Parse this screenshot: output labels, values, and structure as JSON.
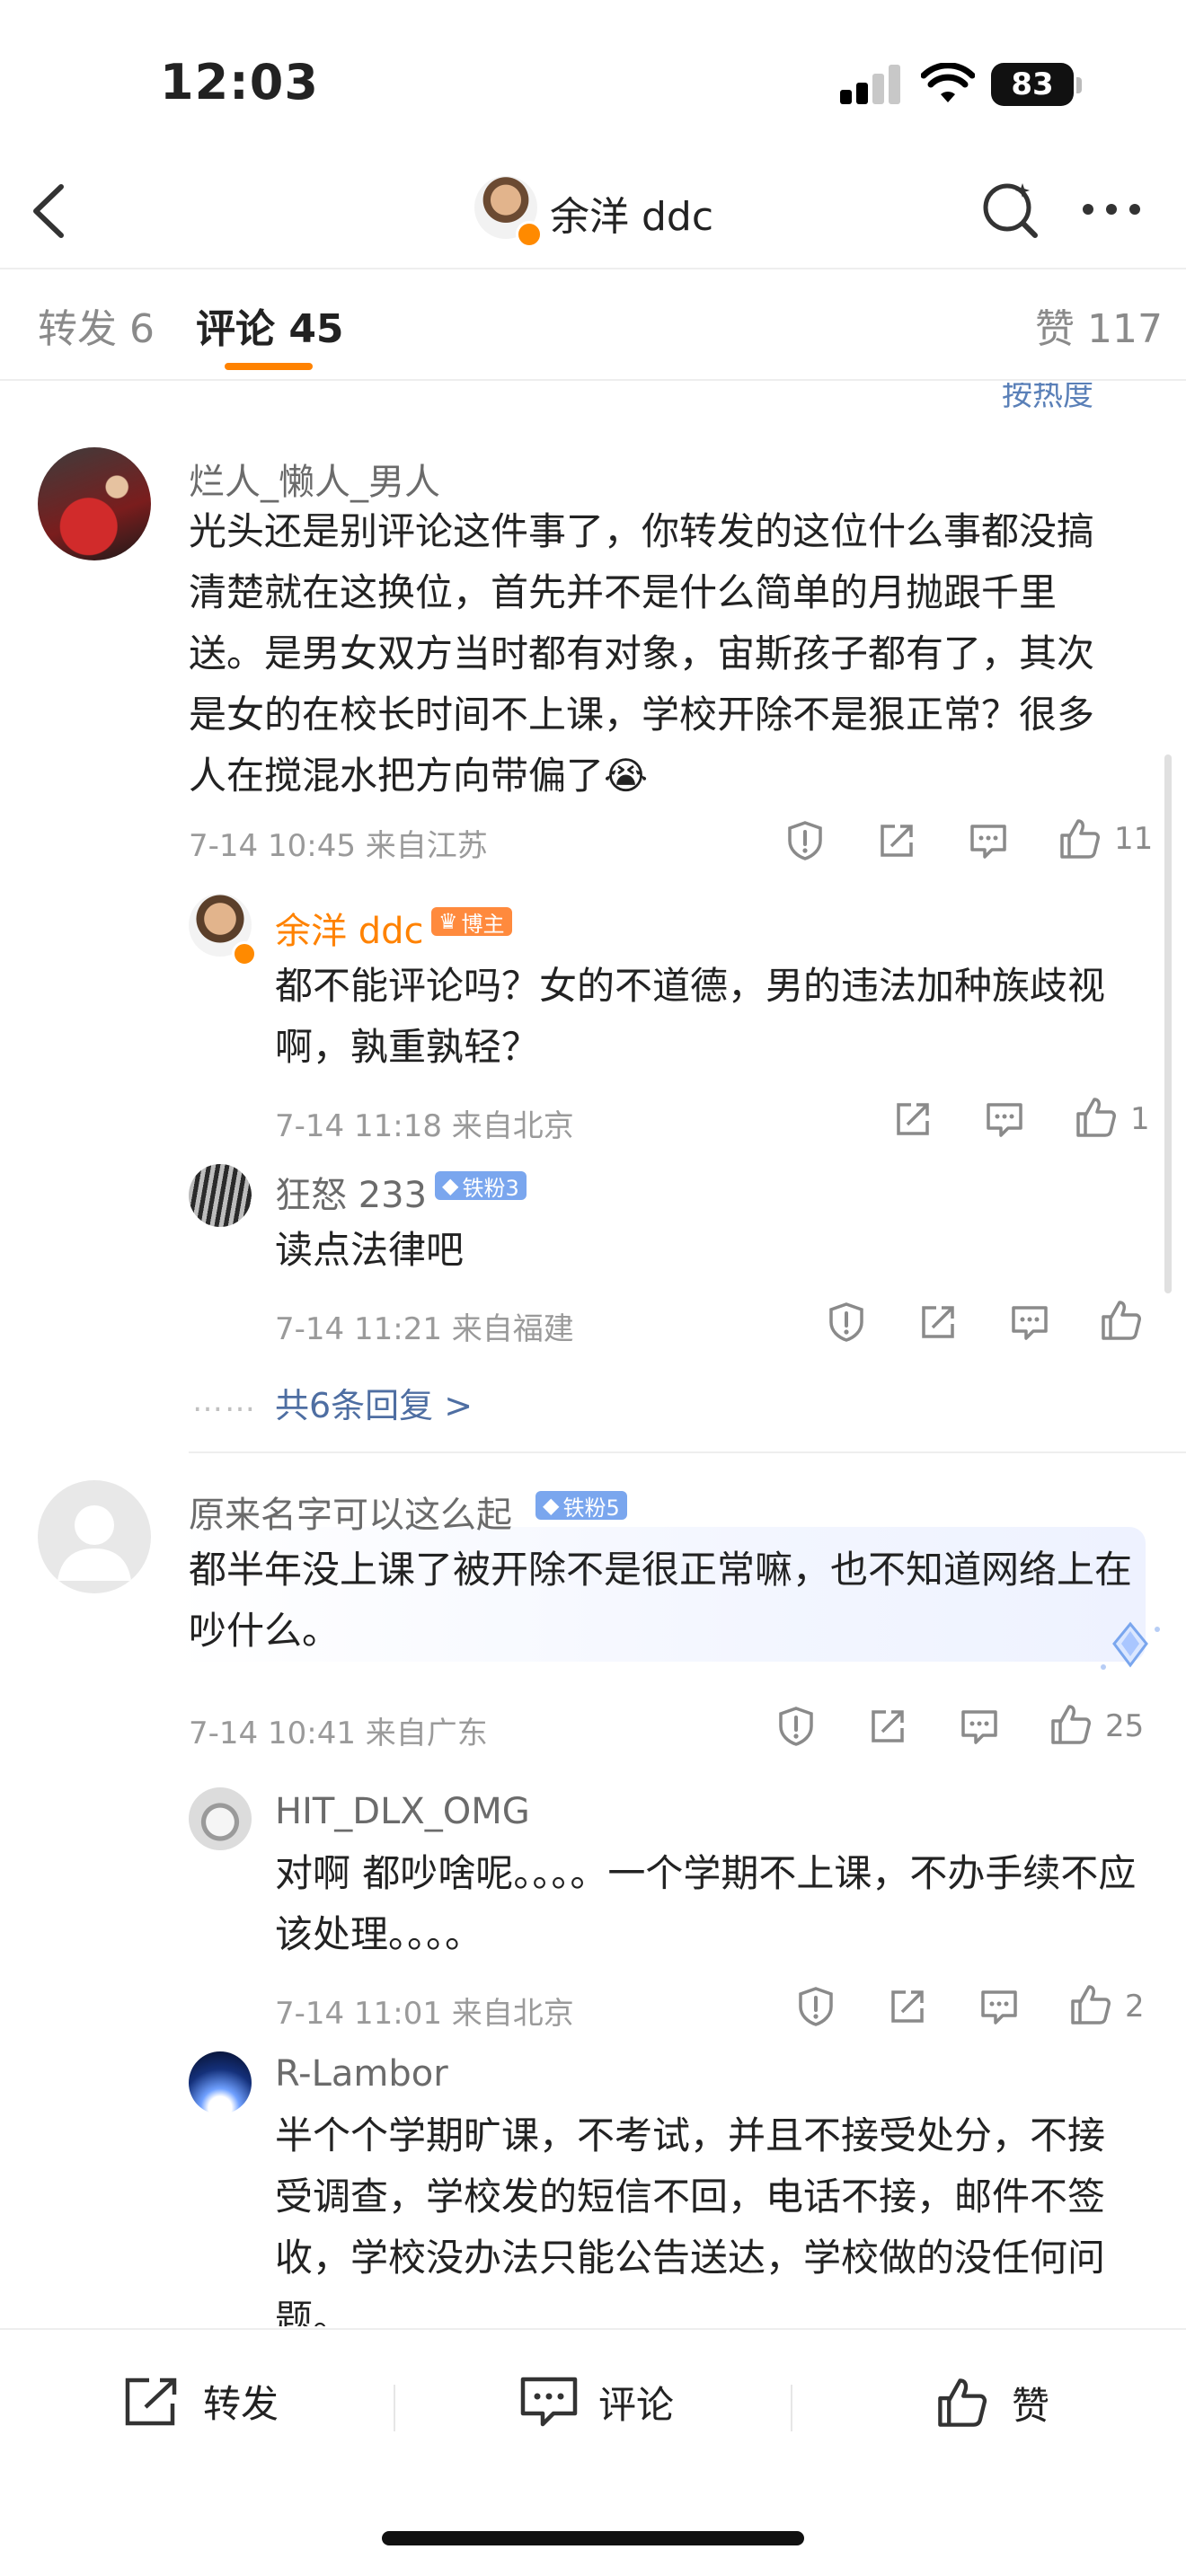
{
  "status_bar": {
    "time": "12:03",
    "battery": "83"
  },
  "nav": {
    "title": "余洋 ddc",
    "icons": [
      "back-icon",
      "search-icon",
      "more-icon"
    ]
  },
  "tabs": [
    {
      "label": "转发 6"
    },
    {
      "label": "评论 45"
    },
    {
      "label": "赞 117"
    }
  ],
  "sort_label": "按热度",
  "comments": [
    {
      "user": "烂人_懒人_男人",
      "text": "光头还是别评论这件事了，你转发的这位什么事都没搞清楚就在这换位，首先并不是什么简单的月抛跟千里送。是男女双方当时都有对象，宙斯孩子都有了，其次是女的在校长时间不上课，学校开除不是狠正常？很多人在搅混水把方向带偏了😭",
      "meta": "7-14 10:45 来自江苏",
      "likes": "11",
      "replies": [
        {
          "user": "余洋 ddc",
          "badge": "博主",
          "text": "都不能评论吗？女的不道德，男的违法加种族歧视啊，孰重孰轻？",
          "meta": "7-14 11:18 来自北京",
          "likes": "1"
        },
        {
          "user": "狂怒 233",
          "badge": "铁粉3",
          "text": "读点法律吧",
          "meta": "7-14 11:21 来自福建",
          "likes": ""
        }
      ],
      "more_replies": "共6条回复 >",
      "dots": "……"
    },
    {
      "user": "原来名字可以这么起",
      "badge": "铁粉5",
      "text": "都半年没上课了被开除不是很正常嘛，也不知道网络上在吵什么。",
      "meta": "7-14 10:41 来自广东",
      "likes": "25",
      "replies": [
        {
          "user": "HIT_DLX_OMG",
          "text": "对啊 都吵啥呢。。。。一个学期不上课，不办手续不应该处理。。。。",
          "meta": "7-14 11:01 来自北京",
          "likes": "2"
        },
        {
          "user": "R-Lambor",
          "text": "半个个学期旷课，不考试，并且不接受处分，不接受调查，学校发的短信不回，电话不接，邮件不签收，学校没办法只能公告送达，学校做的没任何问题。"
        }
      ]
    }
  ],
  "bottom_bar": {
    "repost": "转发",
    "comment": "评论",
    "like": "赞"
  },
  "colors": {
    "accent": "#ff8200",
    "link": "#4e6ea2",
    "fan_badge": "#7aa6ee"
  }
}
